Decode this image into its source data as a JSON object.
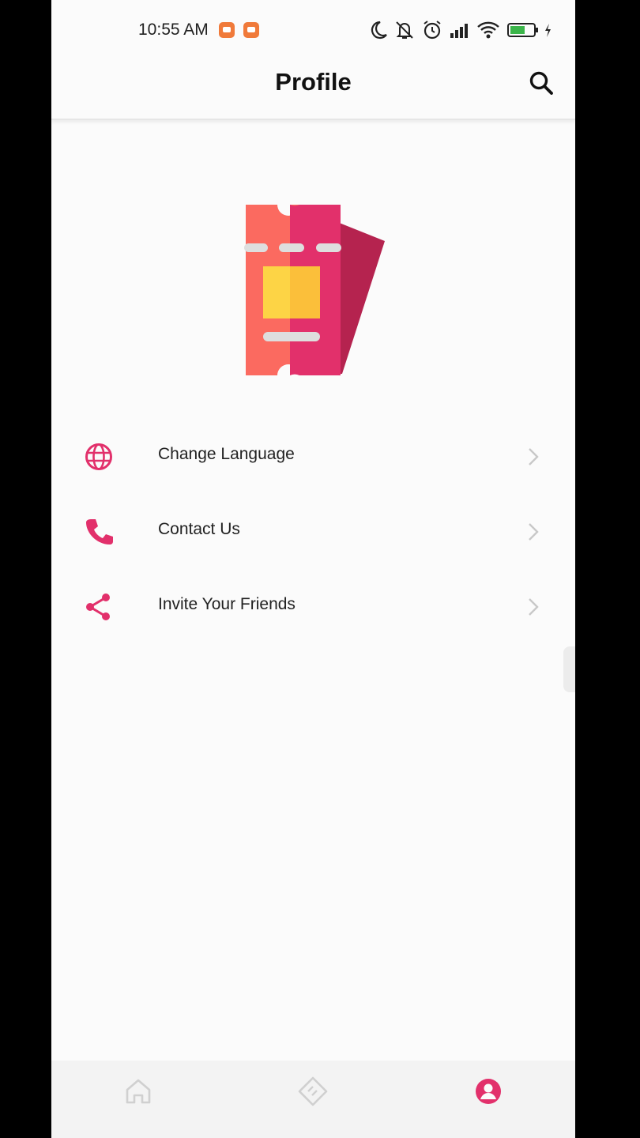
{
  "status_bar": {
    "time": "10:55 AM",
    "icons": [
      "notification-icon",
      "notification-icon",
      "moon-icon",
      "mute-icon",
      "alarm-icon",
      "signal-icon",
      "wifi-icon",
      "battery-icon",
      "charging-icon"
    ]
  },
  "header": {
    "title": "Profile",
    "search_icon": "search-icon"
  },
  "logo": {
    "icon": "ticket-logo",
    "colors": [
      "#fb6a60",
      "#e2306b",
      "#b5234f",
      "#fdd445",
      "#fbbf3a"
    ]
  },
  "menu": {
    "items": [
      {
        "label": "Change Language",
        "icon": "globe-icon"
      },
      {
        "label": "Contact Us",
        "icon": "phone-icon"
      },
      {
        "label": "Invite Your Friends",
        "icon": "share-icon"
      }
    ]
  },
  "bottom_nav": {
    "items": [
      {
        "name": "home",
        "icon": "home-icon",
        "active": false
      },
      {
        "name": "tickets",
        "icon": "ticket-icon",
        "active": false
      },
      {
        "name": "profile",
        "icon": "profile-icon",
        "active": true
      }
    ]
  },
  "colors": {
    "accent": "#e2306b",
    "text": "#222222",
    "inactive_icon": "#cfcfcf",
    "background": "#fbfbfb"
  }
}
